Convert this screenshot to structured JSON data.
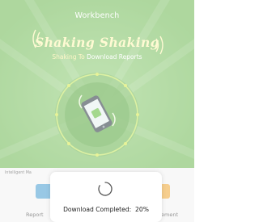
{
  "header": {
    "title": "Workbench"
  },
  "banner": {
    "headline": "Shaking Shaking",
    "subtitle_highlight": "Shaking To",
    "subtitle_rest": "Download Reports",
    "background_color": "#86c56d",
    "phone_icon": "shaking-phone-icon"
  },
  "section": {
    "label": "Intelligent Ma",
    "tabs": [
      {
        "label": "Report"
      },
      {
        "label": "ement"
      }
    ]
  },
  "loading_toast": {
    "status_label": "Download Completed",
    "progress_percent": 20,
    "progress_text": "20%",
    "icon": "spinner-icon"
  }
}
